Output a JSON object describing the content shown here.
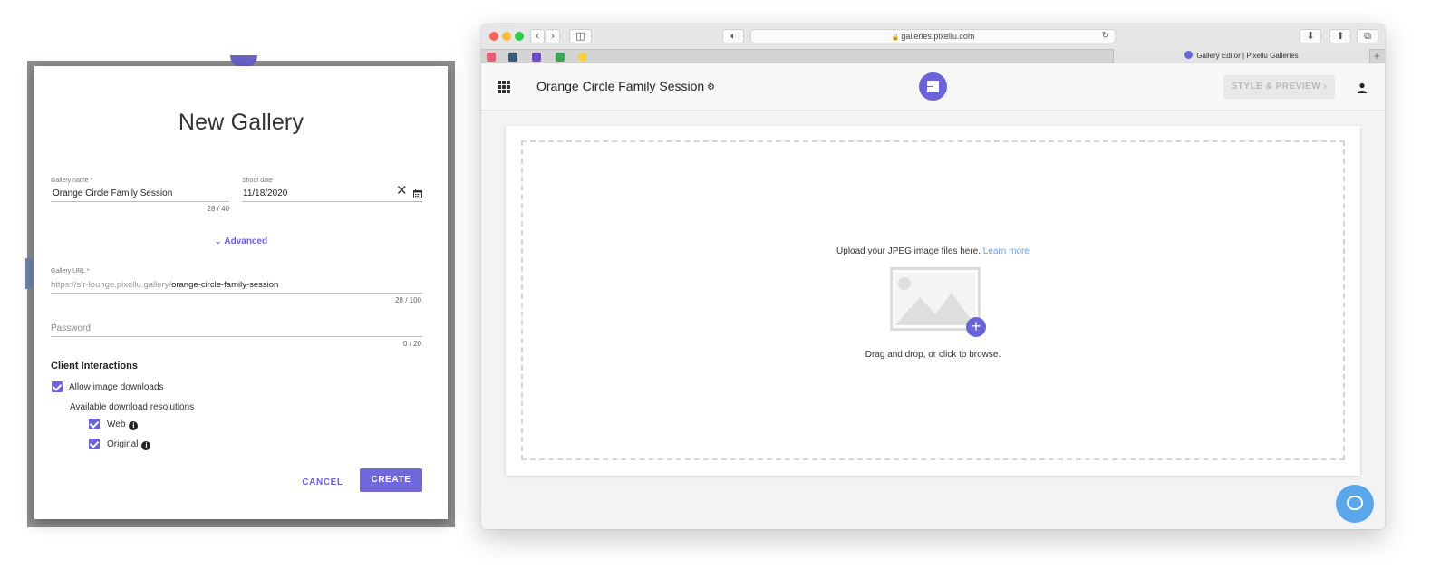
{
  "dialog": {
    "title": "New Gallery",
    "gallery_name_label": "Gallery name *",
    "gallery_name_value": "Orange Circle Family Session",
    "gallery_name_counter": "28 / 40",
    "shoot_date_label": "Shoot date",
    "shoot_date_value": "11/18/2020",
    "advanced_label": "Advanced",
    "gallery_url_label": "Gallery URL *",
    "gallery_url_prefix": "https://slr-lounge.pixellu.gallery/",
    "gallery_url_slug": "orange-circle-family-session",
    "gallery_url_counter": "28 / 100",
    "password_placeholder": "Password",
    "password_counter": "0 / 20",
    "client_interactions_heading": "Client Interactions",
    "allow_downloads_label": "Allow image downloads",
    "allow_downloads_checked": true,
    "resolutions_label": "Available download resolutions",
    "resolution_web_label": "Web",
    "resolution_web_checked": true,
    "resolution_original_label": "Original",
    "resolution_original_checked": true,
    "cancel_label": "CANCEL",
    "create_label": "CREATE",
    "accent_color": "#6b63d6"
  },
  "browser": {
    "address": "galleries.pixellu.com",
    "tab_title": "Gallery Editor | Pixellu Galleries",
    "traffic_lights": [
      "#fc605b",
      "#fdbc40",
      "#34c84a"
    ]
  },
  "app": {
    "gallery_title": "Orange Circle Family Session",
    "style_preview_label": "STYLE & PREVIEW",
    "upload_text": "Upload your JPEG image files here.",
    "learn_more_label": "Learn more",
    "drag_drop_text": "Drag and drop, or click to browse.",
    "chat_color": "#5aa6ea"
  }
}
